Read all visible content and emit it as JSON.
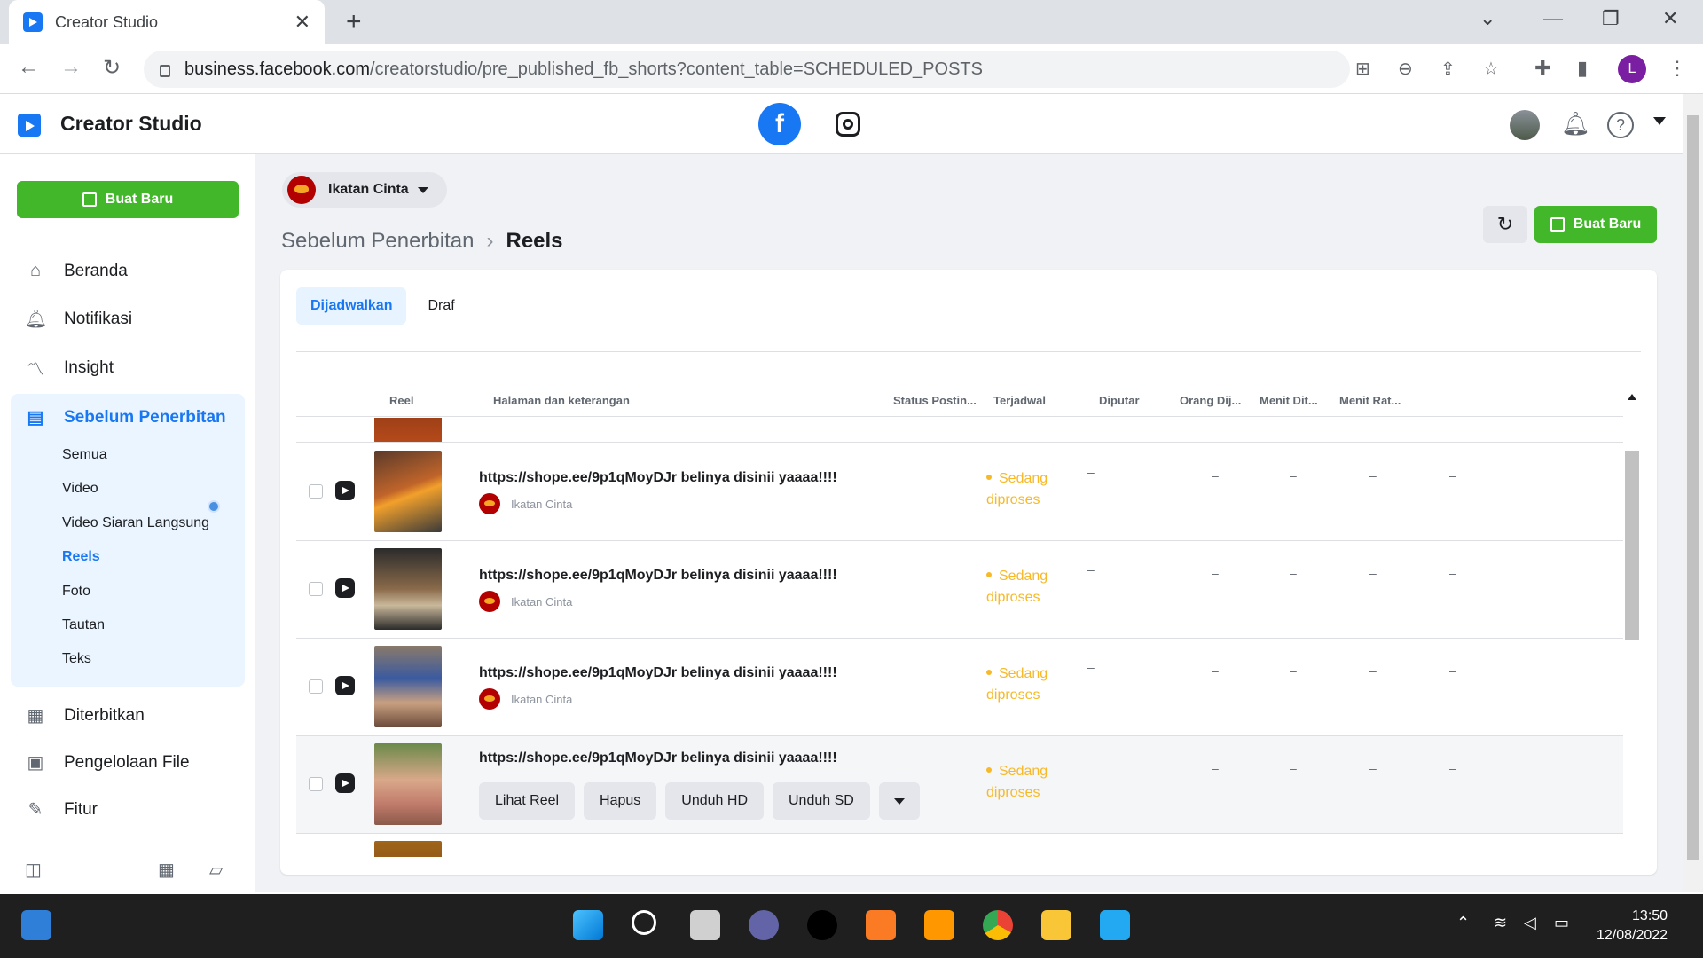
{
  "browser": {
    "tab_title": "Creator Studio",
    "tab_close": "✕",
    "new_tab": "+",
    "url_host": "business.facebook.com",
    "url_path": "/creatorstudio/pre_published_fb_shorts?content_table=SCHEDULED_POSTS",
    "profile_initial": "L"
  },
  "header": {
    "brand": "Creator Studio",
    "facebook_glyph": "f",
    "help_glyph": "?"
  },
  "sidebar": {
    "create_label": "Buat Baru",
    "items": [
      {
        "label": "Beranda",
        "icon": "home-icon"
      },
      {
        "label": "Notifikasi",
        "icon": "bell-icon"
      },
      {
        "label": "Insight",
        "icon": "insight-icon"
      }
    ],
    "group": {
      "label": "Sebelum Penerbitan",
      "subitems": [
        "Semua",
        "Video",
        "Video Siaran Langsung",
        "Reels",
        "Foto",
        "Tautan",
        "Teks"
      ],
      "active": "Reels"
    },
    "items_bottom": [
      {
        "label": "Diterbitkan",
        "icon": "published-icon"
      },
      {
        "label": "Pengelolaan File",
        "icon": "file-icon"
      },
      {
        "label": "Fitur",
        "icon": "tools-icon"
      }
    ]
  },
  "main": {
    "page_name": "Ikatan Cinta",
    "breadcrumb": {
      "parent": "Sebelum Penerbitan",
      "sep": "›",
      "current": "Reels"
    },
    "create_label": "Buat Baru",
    "tabs": [
      "Dijadwalkan",
      "Draf"
    ],
    "active_tab": "Dijadwalkan",
    "columns": [
      "Reel",
      "Halaman dan keterangan",
      "Status Postin...",
      "Terjadwal",
      "Diputar",
      "Orang Dij...",
      "Menit Dit...",
      "Menit Rat..."
    ],
    "rows": [
      {
        "caption": "https://shope.ee/9p1qMoyDJr belinya disinii yaaaa!!!!",
        "owner": "Ikatan Cinta",
        "status_line1": "Sedang",
        "status_line2": "diproses",
        "values": [
          "–",
          "–",
          "–",
          "–",
          "–"
        ]
      },
      {
        "caption": "https://shope.ee/9p1qMoyDJr belinya disinii yaaaa!!!!",
        "owner": "Ikatan Cinta",
        "status_line1": "Sedang",
        "status_line2": "diproses",
        "values": [
          "–",
          "–",
          "–",
          "–",
          "–"
        ]
      },
      {
        "caption": "https://shope.ee/9p1qMoyDJr belinya disinii yaaaa!!!!",
        "owner": "Ikatan Cinta",
        "status_line1": "Sedang",
        "status_line2": "diproses",
        "values": [
          "–",
          "–",
          "–",
          "–",
          "–"
        ]
      },
      {
        "caption": "https://shope.ee/9p1qMoyDJr belinya disinii yaaaa!!!!",
        "owner": "",
        "status_line1": "Sedang",
        "status_line2": "diproses",
        "values": [
          "–",
          "–",
          "–",
          "–",
          "–"
        ]
      }
    ],
    "row_actions": [
      "Lihat Reel",
      "Hapus",
      "Unduh HD",
      "Unduh SD"
    ]
  },
  "taskbar": {
    "time": "13:50",
    "date": "12/08/2022"
  },
  "colors": {
    "primary": "#1877f2",
    "create_green": "#42b72a",
    "status_yellow": "#f7b928"
  }
}
